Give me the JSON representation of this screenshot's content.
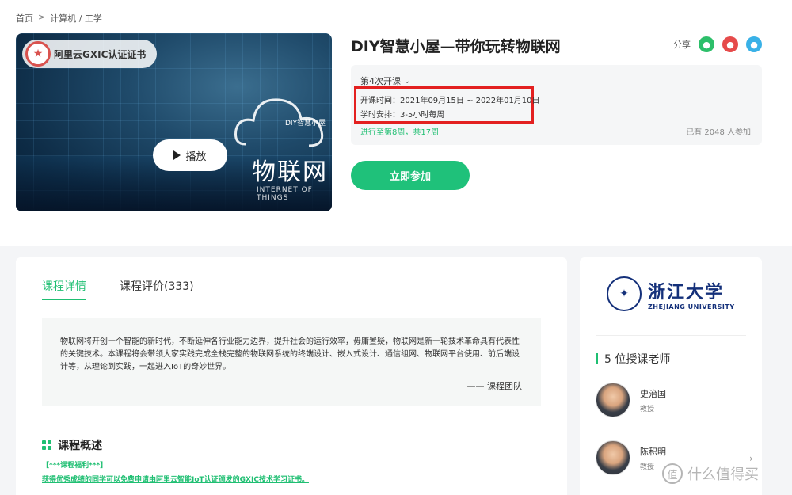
{
  "breadcrumb": {
    "home": "首页",
    "sep": ">",
    "path": "计算机 / 工学"
  },
  "cover": {
    "badge": "阿里云GXIC认证证书",
    "play_label": "播放",
    "logo_text": "物联网",
    "logo_small": "DIY智慧小屋",
    "logo_sub": "INTERNET OF THINGS"
  },
  "course": {
    "title": "DIY智慧小屋—带你玩转物联网",
    "share_label": "分享",
    "session": "第4次开课",
    "dates": "开课时间：2021年09月15日 ~ 2022年01月10日",
    "schedule": "学时安排：3-5小时每周",
    "progress": "进行至第8周，共17周",
    "joined": "已有 2048 人参加",
    "join_button": "立即参加"
  },
  "tabs": [
    {
      "label": "课程详情"
    },
    {
      "label": "课程评价(333)"
    }
  ],
  "description": {
    "text": "物联网将开创一个智能的新时代，不断延伸各行业能力边界，提升社会的运行效率，毋庸置疑，物联网是新一轮技术革命具有代表性的关键技术。本课程将会带领大家实践完成全栈完整的物联网系统的终端设计、嵌入式设计、通信组网、物联网平台使用、前后端设计等，从理论到实践，一起进入IoT的奇妙世界。",
    "signature": "—— 课程团队"
  },
  "overview": {
    "title": "课程概述",
    "bonus_title": "【***课程福利***】",
    "bonus_text": "获得优秀成绩的同学可以免费申请由阿里云智能IoT认证颁发的GXIC技术学习证书。"
  },
  "sidebar": {
    "university_cn": "浙江大学",
    "university_en": "ZHEJIANG UNIVERSITY",
    "teachers_title": "5 位授课老师",
    "teachers": [
      {
        "name": "史治国",
        "role": "教授"
      },
      {
        "name": "陈积明",
        "role": "教授"
      }
    ]
  },
  "watermark": {
    "text": "什么值得买",
    "icon": "值"
  },
  "colors": {
    "accent": "#1fbf72",
    "highlight": "#e32020",
    "university": "#14307a"
  }
}
